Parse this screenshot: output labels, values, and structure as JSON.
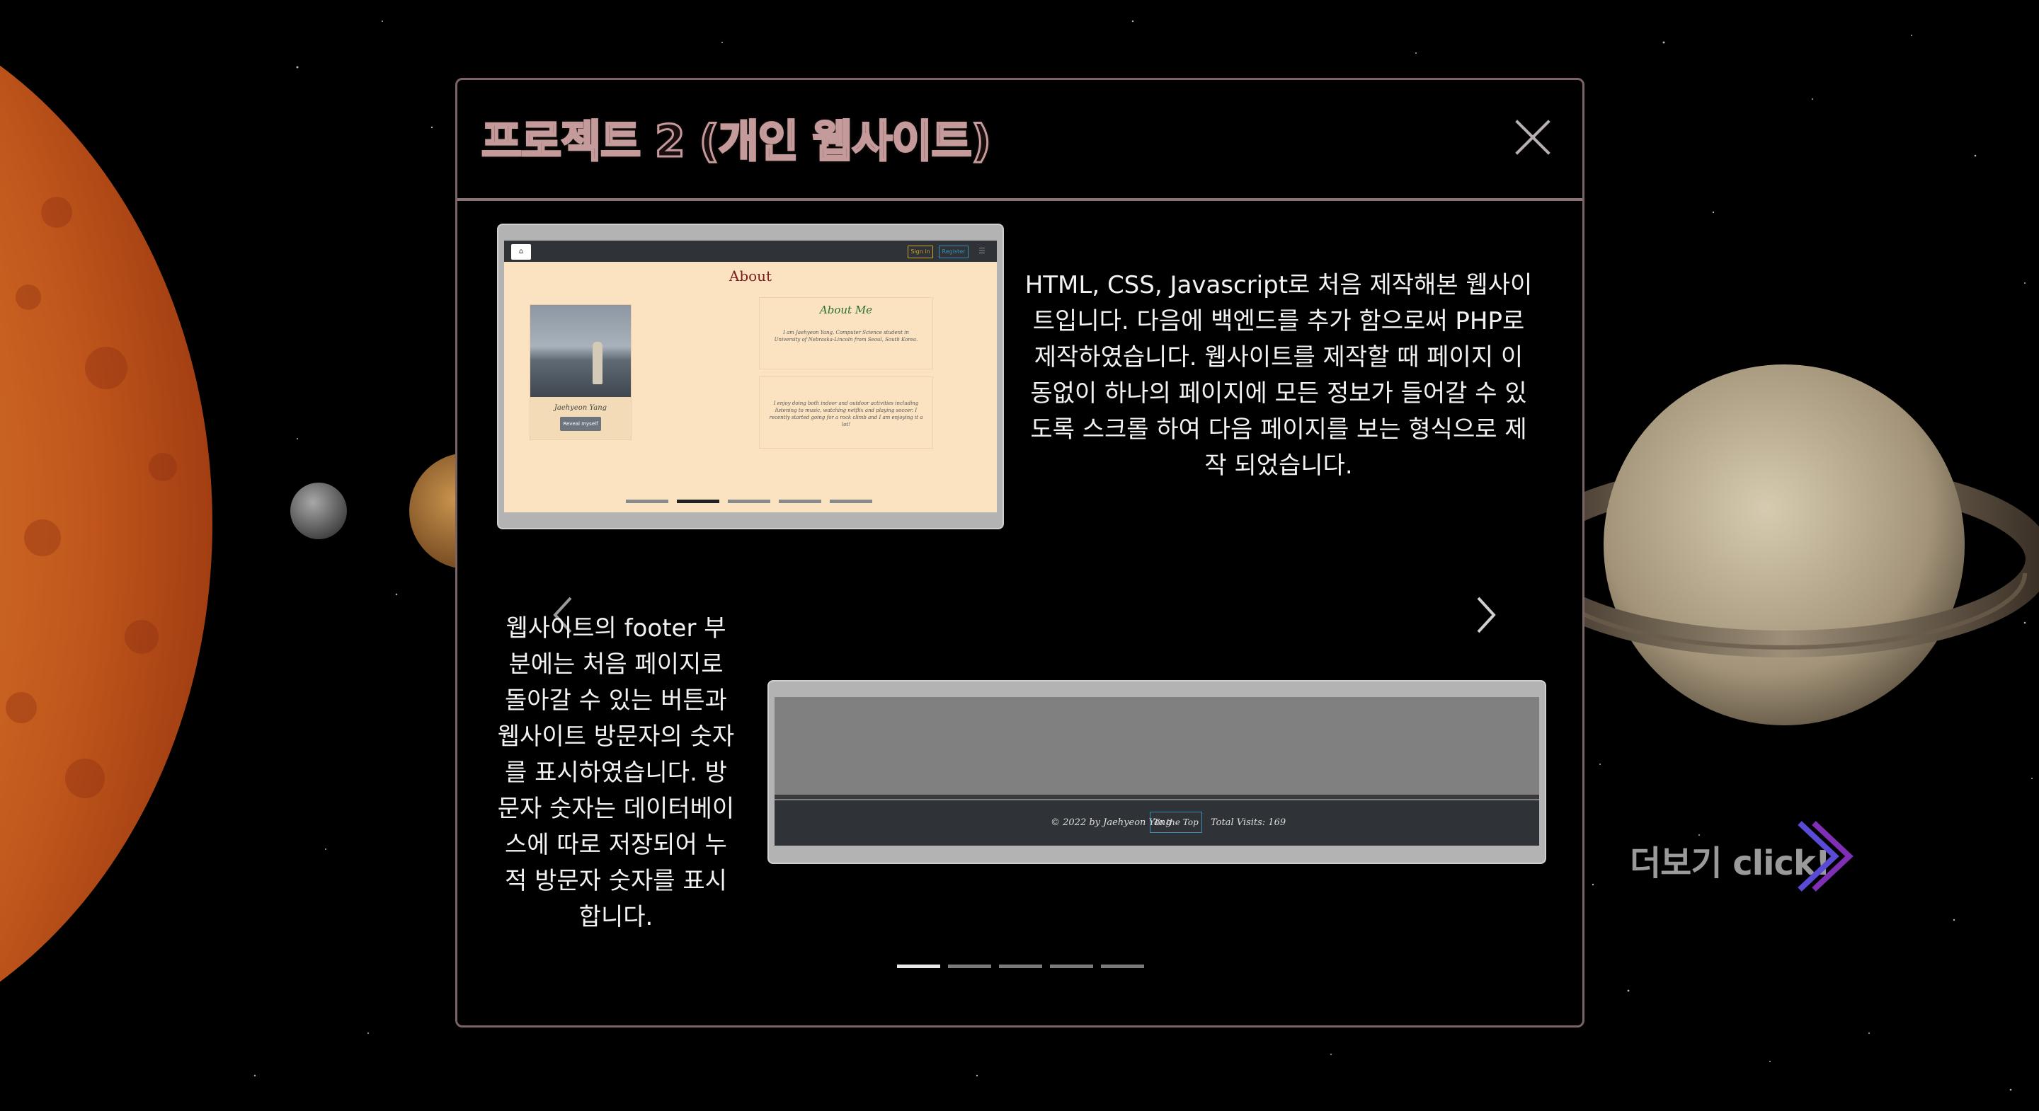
{
  "modal": {
    "title": "프로젝트 2 (개인 웹사이트)",
    "close_icon": "close-icon"
  },
  "slide": {
    "desc1": "HTML, CSS, Javascript로 처음 제작해본 웹사이트입니다. 다음에 백엔드를 추가 함으로써 PHP로 제작하였습니다. 웹사이트를 제작할 때 페이지 이동없이 하나의 페이지에 모든 정보가 들어갈 수 있도록 스크롤 하여 다음 페이지를 보는 형식으로 제작 되었습니다.",
    "desc2": "웹사이트의 footer 부분에는 처음 페이지로 돌아갈 수 있는 버튼과 웹사이트 방문자의 숫자를 표시하였습니다. 방문자 숫자는 데이터베이스에 따로 저장되어 누적 방문자 숫자를 표시 합니다.",
    "prev_icon": "chevron-left-icon",
    "next_icon": "chevron-right-icon",
    "indicator_count": 5,
    "active_indicator": 0
  },
  "screenshot1": {
    "nav_home": "⌂",
    "sign_in": "Sign in",
    "register": "Register",
    "menu": "☰",
    "heading": "About",
    "photo_name": "Jaehyeon Yang",
    "read_button": "Reveal myself",
    "card1_title": "About Me",
    "card1_text": "I am Jaehyeon Yang, Computer Science student in University of Nebraska-Lincoln from Seoul, South Korea.",
    "card2_text": "I enjoy doing both indoor and outdoor activities including listening to music, watching netflix and playing soccer. I recently started going for a rock climb and I am enjoying it a lot!",
    "dot_count": 5,
    "active_dot": 1
  },
  "screenshot2": {
    "copyright": "© 2022 by Jaehyeon Yang",
    "to_top": "To the Top",
    "visits": "Total Visits: 169"
  },
  "more": {
    "label": "더보기 click!",
    "icon": "double-chevron-right-icon"
  },
  "colors": {
    "modal_border": "#7a6465",
    "title_stroke": "#c59a9a",
    "chevron_blue": "#5a4bd6",
    "chevron_purple": "#7e2fb5"
  }
}
